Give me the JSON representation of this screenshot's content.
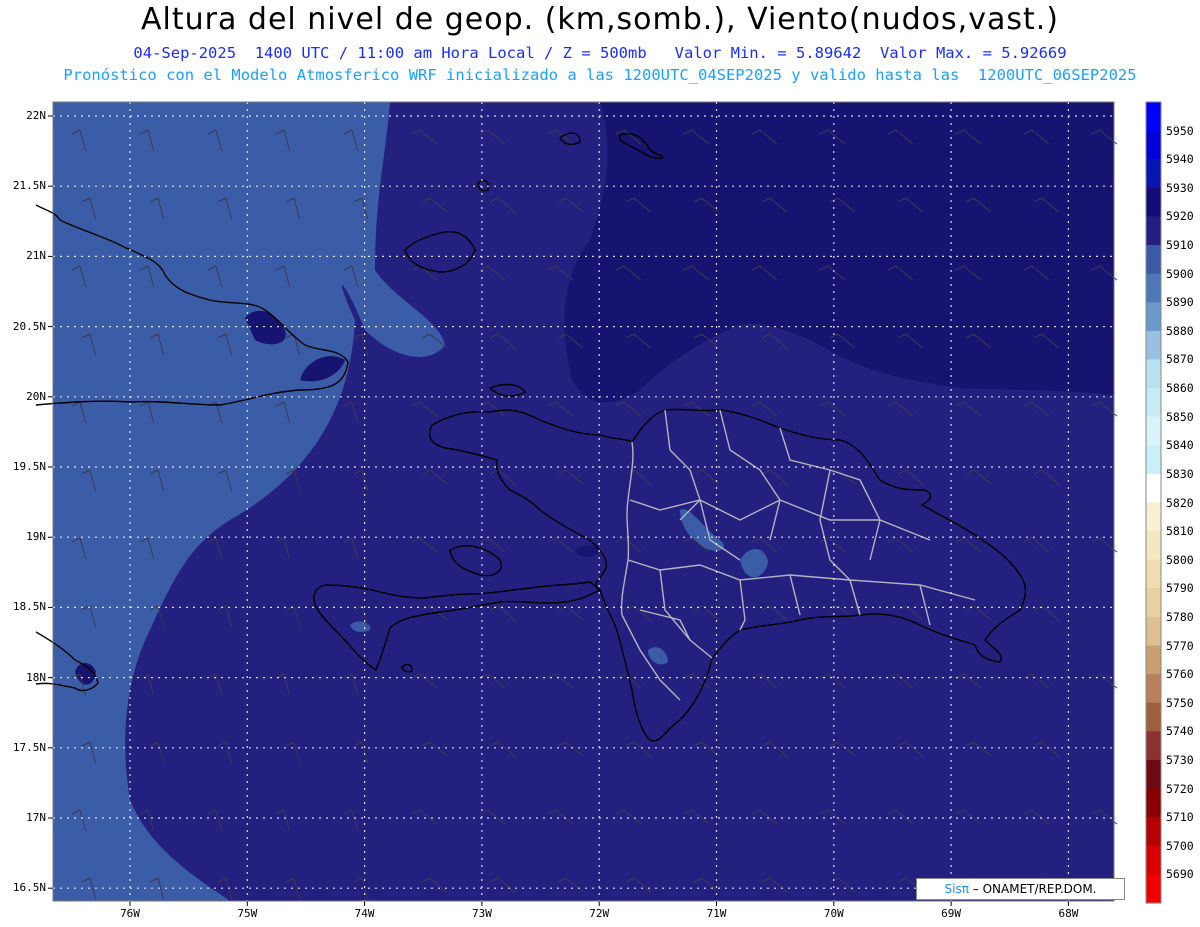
{
  "header": {
    "title": "Altura del nivel de geop. (km,somb.), Viento(nudos,vast.)",
    "line1": "04-Sep-2025  1400 UTC / 11:00 am Hora Local / Z = 500mb   Valor Min. = 5.89642  Valor Max. = 5.92669",
    "line2": "Pronóstico con el Modelo Atmosferico WRF inicializado a las 1200UTC_04SEP2025 y valido hasta las  1200UTC_06SEP2025"
  },
  "axes": {
    "lat_labels": [
      "22N",
      "21.5N",
      "21N",
      "20.5N",
      "20N",
      "19.5N",
      "19N",
      "18.5N",
      "18N",
      "17.5N",
      "17N",
      "16.5N"
    ],
    "lon_labels": [
      "76W",
      "75W",
      "74W",
      "73W",
      "72W",
      "71W",
      "70W",
      "69W",
      "68W"
    ]
  },
  "colorbar": {
    "labels": [
      "5950",
      "5940",
      "5930",
      "5920",
      "5910",
      "5900",
      "5890",
      "5880",
      "5870",
      "5860",
      "5850",
      "5840",
      "5830",
      "5820",
      "5810",
      "5800",
      "5790",
      "5780",
      "5770",
      "5760",
      "5750",
      "5740",
      "5730",
      "5720",
      "5710",
      "5700",
      "5690"
    ],
    "colors": [
      "#0000ff",
      "#0000d8",
      "#0a14b0",
      "#140c7a",
      "#231e80",
      "#3a5aa8",
      "#4f78b8",
      "#6a98c8",
      "#98c0e0",
      "#b8e2f0",
      "#c8ecf4",
      "#d8f4f8",
      "#c8f0f6",
      "#ffffff",
      "#f8f0d0",
      "#f4e8c0",
      "#f0dcb0",
      "#e8d0a0",
      "#dcc090",
      "#c8a070",
      "#b88058",
      "#a06040",
      "#8c3030",
      "#6e0a14",
      "#8a0000",
      "#b40000",
      "#d80000",
      "#f00000"
    ]
  },
  "fields": {
    "colors": {
      "zone_5900": "#3b5ca6",
      "zone_5910": "#24207f",
      "zone_5920": "#171370"
    }
  },
  "credit": {
    "brand": "Sis",
    "pi": "π",
    "sep": "– ",
    "org": "ONAMET/REP.DOM."
  }
}
